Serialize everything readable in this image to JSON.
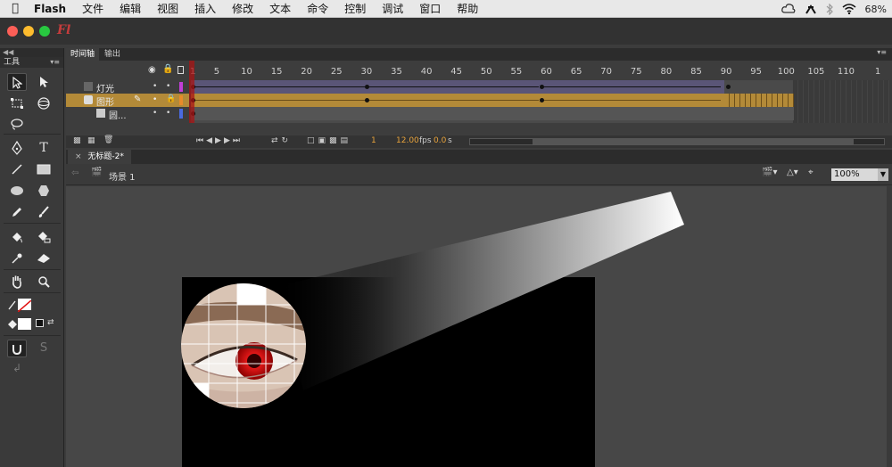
{
  "menubar": {
    "app": "Flash",
    "items": [
      "文件",
      "编辑",
      "视图",
      "插入",
      "修改",
      "文本",
      "命令",
      "控制",
      "调试",
      "窗口",
      "帮助"
    ],
    "battery": "68%"
  },
  "window": {
    "logo": "Fl"
  },
  "toolbox": {
    "title": "工具"
  },
  "timeline": {
    "tabs": [
      "时间轴",
      "输出"
    ],
    "ruler": [
      "1",
      "5",
      "10",
      "15",
      "20",
      "25",
      "30",
      "35",
      "40",
      "45",
      "50",
      "55",
      "60",
      "65",
      "70",
      "75",
      "80",
      "85",
      "90",
      "95",
      "100",
      "105",
      "110",
      "1"
    ],
    "layers": [
      {
        "name": "灯光",
        "color": "#c23ed8"
      },
      {
        "name": "图形",
        "color": "#e88a2a"
      },
      {
        "name": "圆...",
        "color": "#4a6ae0"
      }
    ],
    "current_frame": "1",
    "fps": "12.00",
    "fps_unit": "fps",
    "time": "0.0",
    "time_unit": "s"
  },
  "document": {
    "tab": "无标题-2*",
    "scene": "场景 1",
    "zoom": "100%"
  },
  "colors": {
    "accent": "#b38a38",
    "light_layer_frames": "#5a5577",
    "stage": "#000000",
    "pupil": "#d01818"
  }
}
